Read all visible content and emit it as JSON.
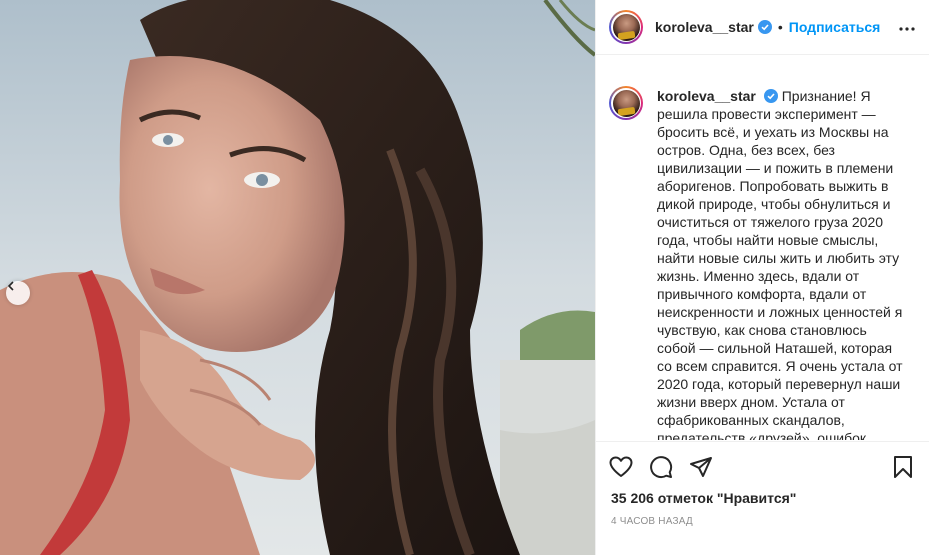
{
  "post": {
    "username": "koroleva__star",
    "follow_label": "Подписаться",
    "separator": "•",
    "caption": "Признание! Я решила провести эксперимент — бросить всё, и уехать из Москвы на остров. Одна, без всех, без цивилизации — и пожить в племени аборигенов. Попробовать выжить в дикой природе, чтобы обнулиться и очиститься от тяжелого груза 2020 года, чтобы найти новые смыслы, найти новые силы жить и любить эту жизнь. Именно здесь, вдали от привычного комфорта, вдали от неискренности и ложных ценностей я чувствую, как снова становлюсь собой — сильной Наташей, которая со всем справится. Я очень устала от 2020 года, который перевернул наши жизни вверх дном. Устала от сфабрикованных скандалов, предательств «друзей», ошибок",
    "likes_text": "35 206 отметок \"Нравится\"",
    "time_text": "4 часов назад"
  },
  "colors": {
    "accent": "#0095f6",
    "verified": "#3897f0",
    "muted": "#8e8e8e",
    "text": "#262626"
  },
  "icons": {
    "verified": "verified-badge-icon",
    "more": "more-options-icon",
    "like": "heart-icon",
    "comment": "comment-icon",
    "share": "paper-plane-icon",
    "save": "bookmark-icon",
    "prev": "chevron-left-icon"
  }
}
